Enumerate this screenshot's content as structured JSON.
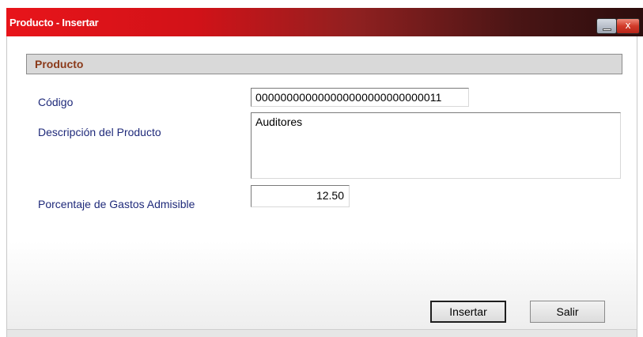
{
  "window": {
    "title": "Producto - Insertar",
    "minimize_icon": "minimize-icon",
    "close_icon": "close-icon",
    "close_glyph": "x",
    "accent_color": "#e8141a"
  },
  "form": {
    "section_title": "Producto",
    "codigo_label": "Código",
    "codigo_value": "000000000000000000000000000011",
    "descripcion_label": "Descripción del Producto",
    "descripcion_value": "Auditores",
    "porcentaje_label": "Porcentaje de Gastos Admisible",
    "porcentaje_value": "12.50"
  },
  "buttons": {
    "insertar_label": "Insertar",
    "salir_label": "Salir"
  }
}
